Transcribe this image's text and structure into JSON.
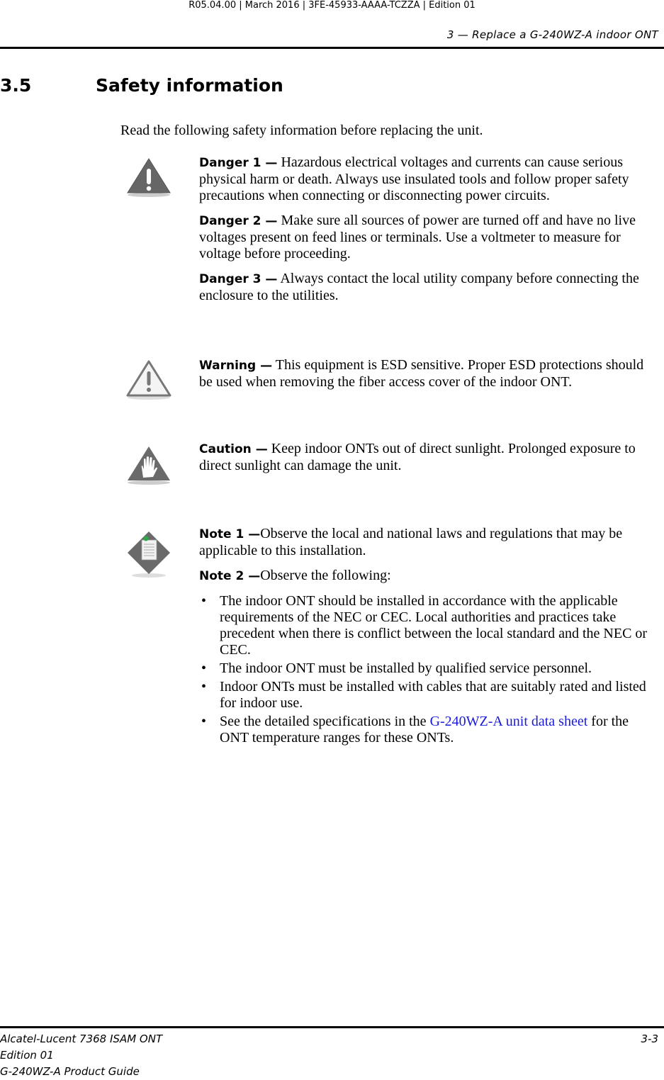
{
  "header": {
    "meta": "R05.04.00 | March 2016 | 3FE-45933-AAAA-TCZZA | Edition 01",
    "chapter": "3 — Replace a G-240WZ-A indoor ONT"
  },
  "section": {
    "number": "3.5",
    "title": "Safety information",
    "intro": "Read the following safety information before replacing the unit."
  },
  "danger": {
    "icon": "danger-triangle-icon",
    "items": [
      {
        "label": "Danger 1 —",
        "text": " Hazardous electrical voltages and currents can cause serious physical harm or death. Always use insulated tools and follow proper safety precautions when connecting or disconnecting power circuits."
      },
      {
        "label": "Danger 2 —",
        "text": " Make sure all sources of power are turned off and have no live voltages present on feed lines or terminals. Use a voltmeter to measure for voltage before proceeding."
      },
      {
        "label": "Danger 3 —",
        "text": " Always contact the local utility company before connecting the enclosure to the utilities."
      }
    ]
  },
  "warning": {
    "icon": "warning-triangle-icon",
    "label": "Warning —",
    "text": " This equipment is ESD sensitive. Proper ESD protections should be used when removing the fiber access cover of the indoor ONT."
  },
  "caution": {
    "icon": "caution-hand-icon",
    "label": "Caution —",
    "text": " Keep indoor ONTs out of direct sunlight. Prolonged exposure to direct sunlight can damage the unit."
  },
  "note": {
    "icon": "note-document-icon",
    "note1_label": "Note 1 —",
    "note1_text": "Observe the local and national laws and regulations that may be applicable to this installation.",
    "note2_label": "Note 2 —",
    "note2_text": "Observe the following:",
    "bullets": [
      "The indoor ONT should be installed in accordance with the applicable requirements of the NEC or CEC. Local authorities and practices take precedent when there is conflict between the local standard and the NEC or CEC.",
      "The indoor ONT must be installed by qualified service personnel.",
      "Indoor ONTs must be installed with cables that are suitably rated and listed for indoor use."
    ],
    "last_bullet_pre": "See the detailed specifications in the ",
    "last_bullet_link": "G-240WZ-A unit data sheet",
    "last_bullet_post": " for the ONT temperature ranges for these ONTs.",
    "link_color": "#1a1adb"
  },
  "footer": {
    "product": "Alcatel-Lucent 7368 ISAM ONT",
    "edition": "Edition 01",
    "guide": "G-240WZ-A Product Guide",
    "page": "3-3"
  }
}
